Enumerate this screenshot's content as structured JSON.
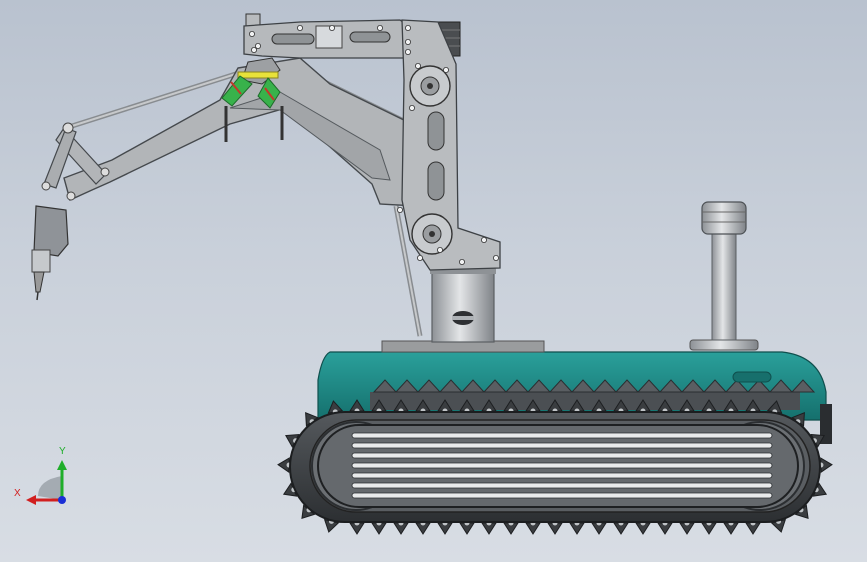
{
  "triad": {
    "x_label": "X",
    "y_label": "Y",
    "colors": {
      "x": "#d11f1f",
      "y": "#1fae2a",
      "z": "#1a2fd6"
    }
  },
  "model": {
    "body_color": "#1f8a87",
    "track_color": "#3a3d40",
    "steel_color": "#b9bcbf",
    "highlight_color": "#e8e23a",
    "green_color": "#38b24b"
  }
}
